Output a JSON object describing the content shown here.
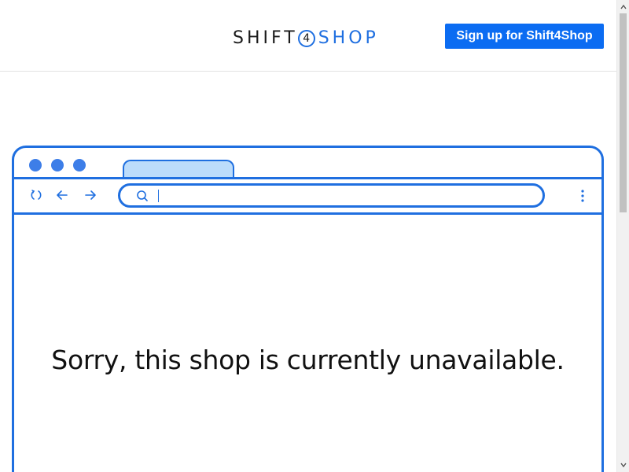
{
  "header": {
    "logo_shift": "SHIFT",
    "logo_four": "4",
    "logo_shop": "SHOP",
    "signup_label": "Sign up for Shift4Shop"
  },
  "illustration": {
    "message": "Sorry, this shop is currently unavailable."
  },
  "icons": {
    "reload": "reload-icon",
    "back": "back-arrow-icon",
    "forward": "forward-arrow-icon",
    "search": "search-icon",
    "menu": "kebab-menu-icon"
  },
  "colors": {
    "brand_blue": "#1f6fe0",
    "button_blue": "#0b6cf2",
    "tab_fill": "#bcdcfb",
    "dot": "#3d7ee8",
    "text": "#111111"
  }
}
